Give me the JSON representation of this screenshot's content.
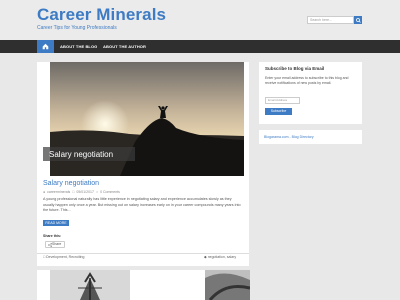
{
  "header": {
    "site_title": "Career Minerals",
    "tagline": "Career Tips for Young Professionals",
    "search_placeholder": "Search here..."
  },
  "nav": {
    "items": [
      {
        "label": "ABOUT THE BLOG"
      },
      {
        "label": "ABOUT THE AUTHOR"
      }
    ]
  },
  "post": {
    "image_caption": "Salary negotiation",
    "title": "Salary negotiation",
    "meta": {
      "author": "careerminerals",
      "date": "05/01/2017",
      "comments": "0 Comments"
    },
    "excerpt": "A young professional naturally has little experience in negotiating salary and experience accumulates slowly as they usually happen only once a year. But missing out on salary increases early on in your career compounds many years into the future. This...",
    "read_more": "READ MORE",
    "share_label": "Share this:",
    "share_button": "Share",
    "footer_categories": "Development, Recruiting",
    "footer_tags": "negotiation, salary"
  },
  "sidebar": {
    "subscribe_title": "Subscribe to Blog via Email",
    "subscribe_text": "Enter your email address to subscribe to this blog and receive notifications of new posts by email.",
    "email_placeholder": "Email Address",
    "subscribe_button": "Subscribe",
    "link": "Blogarama.com - Blog Directory"
  },
  "colors": {
    "accent": "#3d7bc4",
    "nav_bg": "#2f2f2f",
    "page_bg": "#e8e8e8"
  }
}
